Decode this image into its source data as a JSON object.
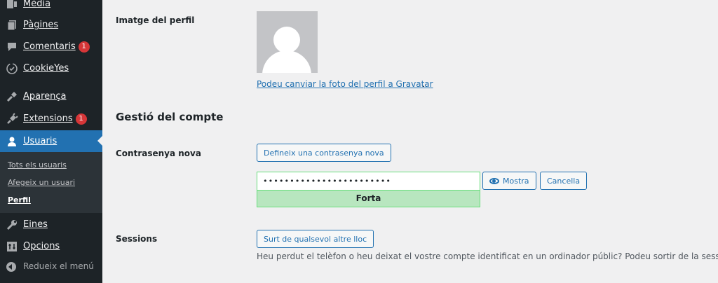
{
  "sidebar": {
    "items": [
      {
        "label": "Mèdia",
        "icon": "media-icon"
      },
      {
        "label": "Pàgines",
        "icon": "pages-icon"
      },
      {
        "label": "Comentaris",
        "icon": "comments-icon",
        "badge": "1"
      },
      {
        "label": "CookieYes",
        "icon": "cookieyes-icon"
      },
      {
        "label": "Aparença",
        "icon": "appearance-icon"
      },
      {
        "label": "Extensions",
        "icon": "plugins-icon",
        "badge": "1"
      },
      {
        "label": "Usuaris",
        "icon": "users-icon",
        "current": true
      },
      {
        "label": "Eines",
        "icon": "tools-icon"
      },
      {
        "label": "Opcions",
        "icon": "settings-icon"
      }
    ],
    "submenu": [
      {
        "label": "Tots els usuaris"
      },
      {
        "label": "Afegeix un usuari"
      },
      {
        "label": "Perfil",
        "active": true
      }
    ],
    "collapse_label": "Redueix el menú"
  },
  "profile": {
    "picture_label": "Imatge del perfil",
    "gravatar_link": "Podeu canviar la foto del perfil a Gravatar",
    "gravatar_suffix": ".",
    "account_section_title": "Gestió del compte",
    "new_password_label": "Contrasenya nova",
    "set_password_button": "Defineix una contrasenya nova",
    "password_value": "••••••••••••••••••••••••",
    "password_strength": "Forta",
    "show_button": "Mostra",
    "cancel_button": "Cancella",
    "sessions_label": "Sessions",
    "logout_everywhere_button": "Surt de qualsevol altre lloc",
    "sessions_description": "Heu perdut el telèfon o heu deixat el vostre compte identificat en un ordinador públic? Podeu sortir de la sessió a to"
  },
  "colors": {
    "sidebar_bg": "#1d2327",
    "accent": "#2271b1",
    "badge": "#d63638",
    "strength_strong": "#b8e6bf"
  }
}
